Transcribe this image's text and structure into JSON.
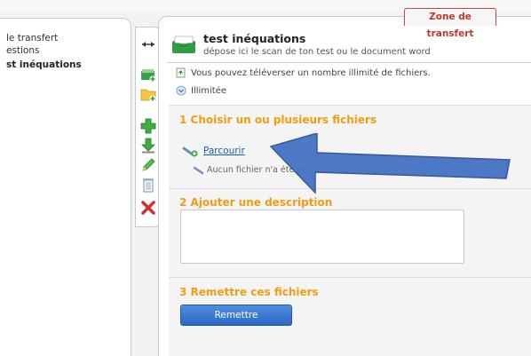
{
  "tree": {
    "items": [
      {
        "label": "le transfert"
      },
      {
        "label": "estions"
      },
      {
        "label": "st inéquations"
      }
    ]
  },
  "toolbar": {
    "icons": [
      "swap-arrows-icon",
      "add-mailbox-icon",
      "new-folder-icon",
      "add-plus-icon",
      "download-icon",
      "edit-pencil-icon",
      "trash-icon",
      "delete-x-icon"
    ]
  },
  "zone_tab": {
    "label": "Zone de transfert"
  },
  "header": {
    "title": "test inéquations",
    "subtitle": "dépose ici le scan de ton test ou le document word"
  },
  "info": {
    "upload_note": "Vous pouvez téléverser un nombre illimité de fichiers.",
    "limit": "Illimitée"
  },
  "step1": {
    "title": "1 Choisir un ou plusieurs fichiers",
    "browse": "Parcourir",
    "no_file": "Aucun fichier n'a été sélectionné."
  },
  "step2": {
    "title": "2 Ajouter une description",
    "description_value": ""
  },
  "step3": {
    "title": "3 Remettre ces fichiers",
    "button": "Remettre"
  },
  "colors": {
    "accent_orange": "#f39c12",
    "button_blue": "#2b67c4",
    "arrow_blue": "#4472c4",
    "tab_red": "#c0392b"
  }
}
